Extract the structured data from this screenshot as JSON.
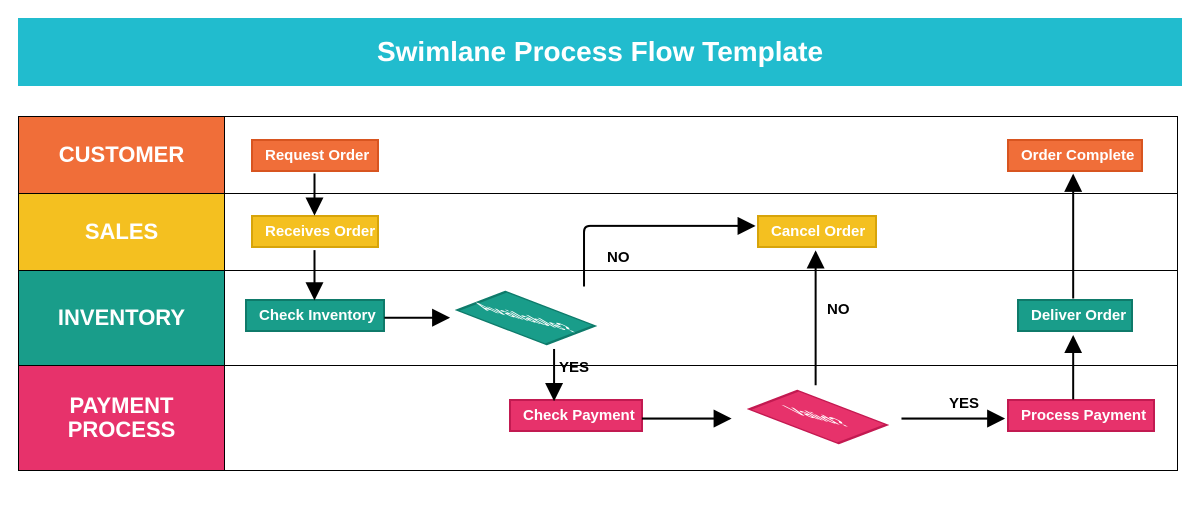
{
  "title": "Swimlane Process Flow Template",
  "lanes": {
    "customer": "CUSTOMER",
    "sales": "SALES",
    "inventory": "INVENTORY",
    "payment": "PAYMENT PROCESS"
  },
  "nodes": {
    "requestOrder": "Request Order",
    "receivesOrder": "Receives Order",
    "checkInventory": "Check Inventory",
    "available": "Available?",
    "checkPayment": "Check Payment",
    "valid": "Valid?",
    "cancelOrder": "Cancel Order",
    "processPayment": "Process Payment",
    "deliverOrder": "Deliver Order",
    "orderComplete": "Order Complete"
  },
  "labels": {
    "yes": "YES",
    "no": "NO"
  },
  "colors": {
    "titleBar": "#21bcce",
    "customer": "#f06e39",
    "sales": "#f4c020",
    "inventory": "#199d8a",
    "payment": "#e7326b"
  }
}
